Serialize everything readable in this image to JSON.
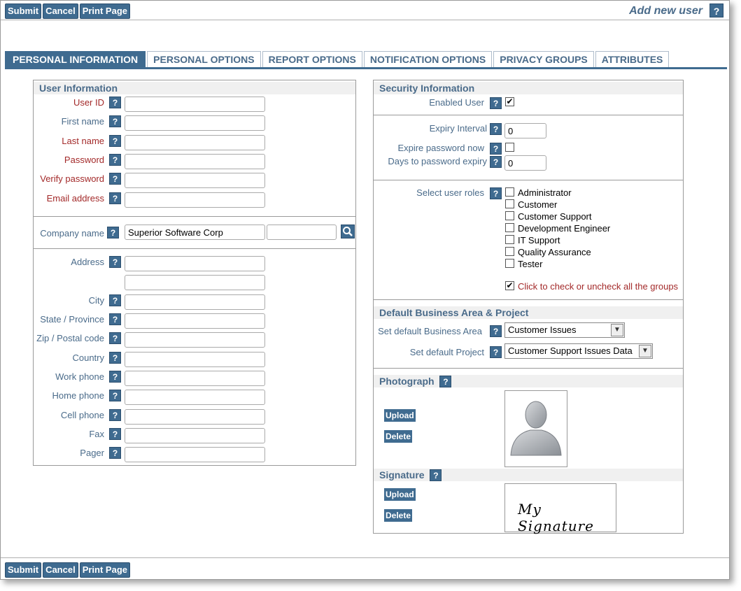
{
  "toolbar": {
    "submit": "Submit",
    "cancel": "Cancel",
    "print": "Print Page"
  },
  "page_title": "Add new user",
  "help_glyph": "?",
  "tabs": [
    {
      "label": "PERSONAL INFORMATION",
      "active": true
    },
    {
      "label": "PERSONAL OPTIONS"
    },
    {
      "label": "REPORT OPTIONS"
    },
    {
      "label": "NOTIFICATION OPTIONS"
    },
    {
      "label": "PRIVACY GROUPS"
    },
    {
      "label": "ATTRIBUTES"
    }
  ],
  "user_info": {
    "heading": "User Information",
    "user_id": "User ID",
    "first_name": "First name",
    "last_name": "Last name",
    "password": "Password",
    "verify_password": "Verify password",
    "email": "Email address"
  },
  "company": {
    "label": "Company name",
    "value": "Superior Software Corp",
    "value2": ""
  },
  "address": {
    "address": "Address",
    "city": "City",
    "state": "State / Province",
    "zip": "Zip / Postal code",
    "country": "Country",
    "work_phone": "Work phone",
    "home_phone": "Home phone",
    "cell_phone": "Cell phone",
    "fax": "Fax",
    "pager": "Pager"
  },
  "security": {
    "heading": "Security Information",
    "enabled_user": "Enabled User",
    "enabled_checked": true,
    "expiry_interval": "Expiry Interval",
    "expiry_interval_value": "0",
    "expire_password_now": "Expire password now",
    "days_to_expiry": "Days to password expiry",
    "days_to_expiry_value": "0",
    "select_roles": "Select user roles",
    "roles": [
      "Administrator",
      "Customer",
      "Customer Support",
      "Development Engineer",
      "IT Support",
      "Quality Assurance",
      "Tester"
    ],
    "check_all": "Click to check or uncheck all the groups",
    "check_mark": "✔"
  },
  "defaults": {
    "heading": "Default Business Area & Project",
    "business_area_label": "Set default Business Area",
    "business_area_value": "Customer Issues",
    "project_label": "Set default Project",
    "project_value": "Customer Support Issues Data",
    "arrow": "▼"
  },
  "photo": {
    "heading": "Photograph",
    "upload": "Upload",
    "delete": "Delete"
  },
  "signature": {
    "heading": "Signature",
    "upload": "Upload",
    "delete": "Delete",
    "text": "My Signature"
  },
  "colors": {
    "accent": "#3f6b90",
    "label": "#4a6b8a",
    "required": "#a32a2a"
  },
  "icons": {
    "search": "search-icon",
    "help": "help-icon",
    "avatar": "person-silhouette-icon"
  }
}
